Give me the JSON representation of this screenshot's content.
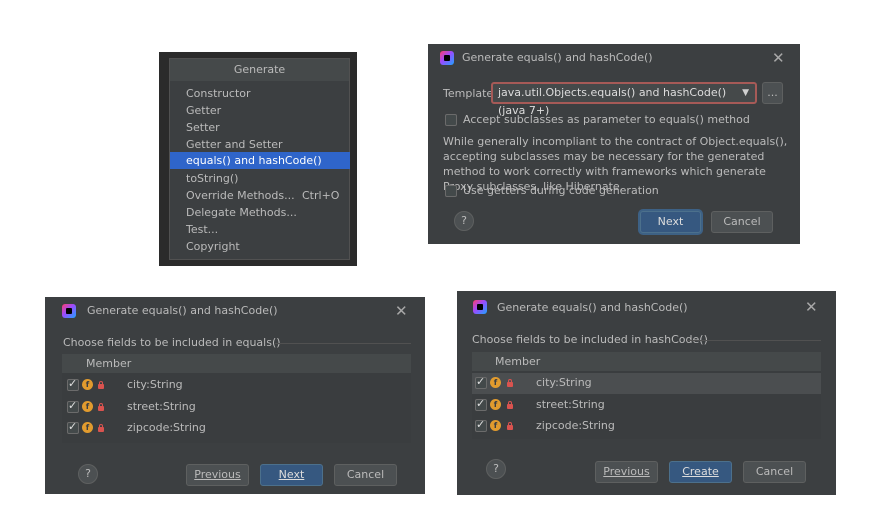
{
  "generate_menu": {
    "header": "Generate",
    "items": [
      {
        "label": "Constructor",
        "shortcut": ""
      },
      {
        "label": "Getter",
        "shortcut": ""
      },
      {
        "label": "Setter",
        "shortcut": ""
      },
      {
        "label": "Getter and Setter",
        "shortcut": ""
      },
      {
        "label": "equals() and hashCode()",
        "shortcut": ""
      },
      {
        "label": "toString()",
        "shortcut": ""
      },
      {
        "label": "Override Methods...",
        "shortcut": "Ctrl+O"
      },
      {
        "label": "Delegate Methods...",
        "shortcut": ""
      },
      {
        "label": "Test...",
        "shortcut": ""
      },
      {
        "label": "Copyright",
        "shortcut": ""
      }
    ],
    "selected": "equals() and hashCode()"
  },
  "template_dialog": {
    "title": "Generate equals() and hashCode()",
    "template_label": "Template:",
    "template_value": "java.util.Objects.equals() and hashCode() (java 7+)",
    "more_button": "...",
    "accept_subclasses": "Accept subclasses as parameter to equals() method",
    "description": "While generally incompliant to the contract of Object.equals(), accepting subclasses may be necessary for the generated method to work correctly with frameworks which generate Proxy subclasses, like Hibernate.",
    "use_getters": "Use getters during code generation",
    "next": "Next",
    "cancel": "Cancel",
    "help": "?"
  },
  "equals_dialog": {
    "title": "Generate equals() and hashCode()",
    "choose_label": "Choose fields to be included in equals()",
    "column": "Member",
    "fields": [
      "city:String",
      "street:String",
      "zipcode:String"
    ],
    "previous": "Previous",
    "next": "Next",
    "cancel": "Cancel",
    "help": "?"
  },
  "hashcode_dialog": {
    "title": "Generate equals() and hashCode()",
    "choose_label": "Choose fields to be included in hashCode()",
    "column": "Member",
    "fields": [
      "city:String",
      "street:String",
      "zipcode:String"
    ],
    "previous": "Previous",
    "create": "Create",
    "cancel": "Cancel",
    "help": "?"
  },
  "colors": {
    "dialog_bg": "#3c3f41",
    "selection": "#2f65ca",
    "primary_button": "#365880",
    "field_icon": "#e19b2e",
    "lock_icon": "#d9534f"
  }
}
